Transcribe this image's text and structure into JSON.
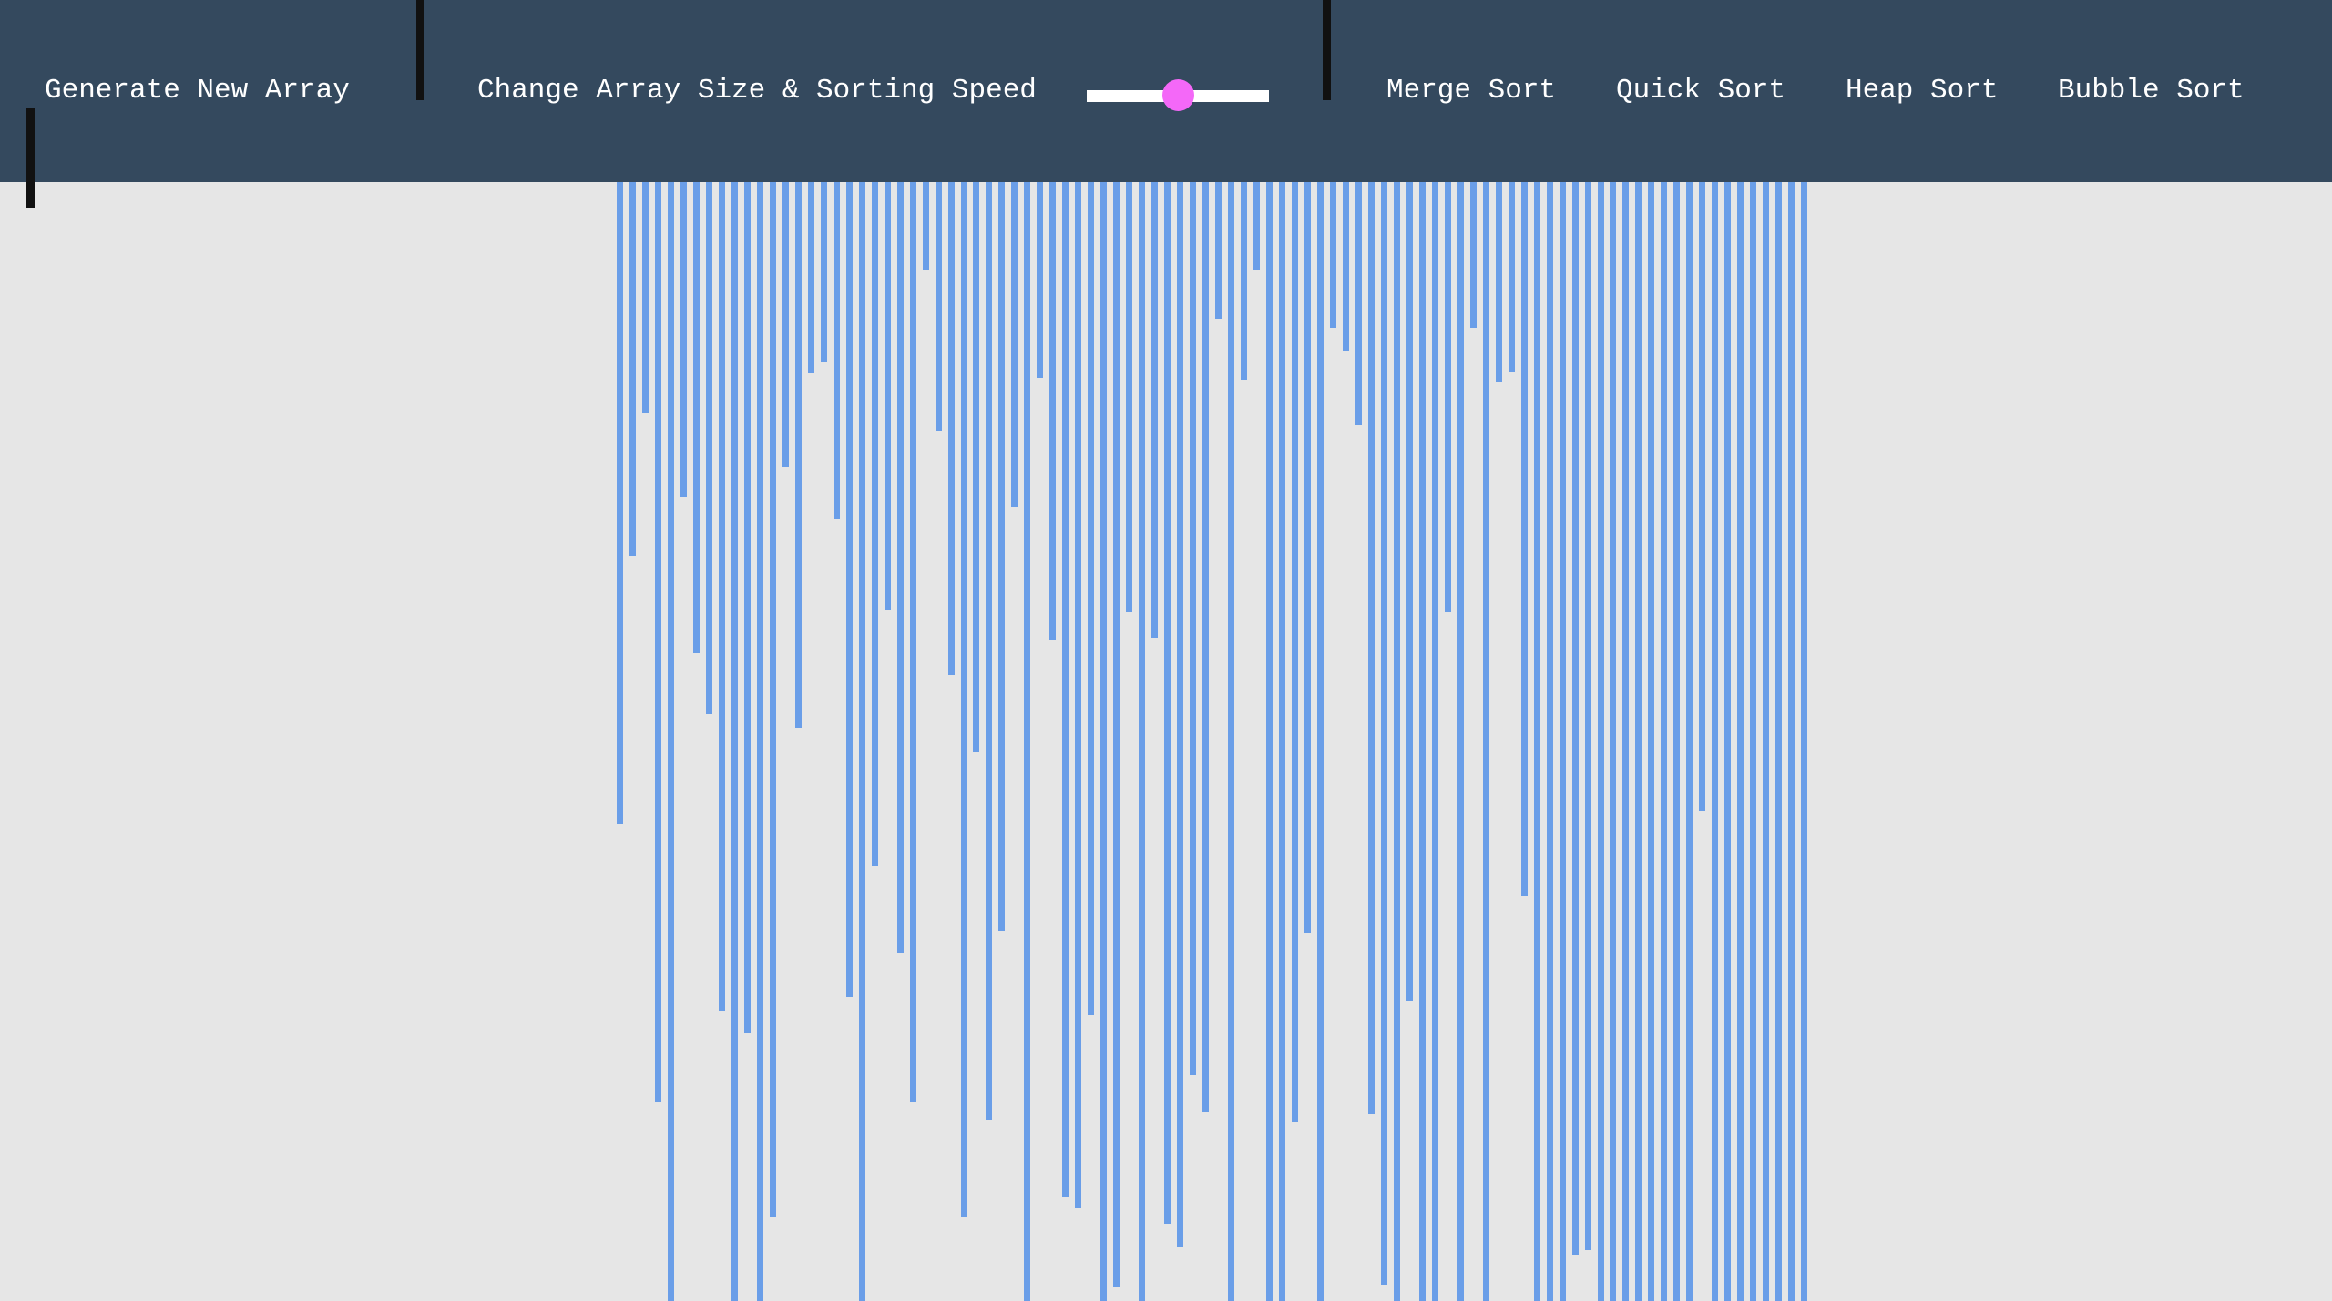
{
  "navbar": {
    "generate_label": "Generate New Array",
    "size_speed_label": "Change Array Size & Sorting Speed",
    "slider_value": 0.5,
    "algorithms": [
      "Merge Sort",
      "Quick Sort",
      "Heap Sort",
      "Bubble Sort"
    ]
  },
  "colors": {
    "navbar": "#34495e",
    "background": "#e6e6e6",
    "bar": "#6a9ee8",
    "slider_thumb": "#f468f8",
    "slider_track": "#ffffff",
    "text": "#ffffff"
  },
  "array": {
    "values": [
      704,
      410,
      253,
      1010,
      1231,
      345,
      517,
      584,
      910,
      1231,
      934,
      1231,
      1136,
      313,
      599,
      209,
      197,
      370,
      894,
      1231,
      751,
      469,
      846,
      1010,
      96,
      273,
      541,
      1136,
      625,
      1029,
      822,
      356,
      1231,
      215,
      503,
      1114,
      1126,
      914,
      1231,
      1213,
      472,
      1231,
      500,
      1143,
      1169,
      980,
      1021,
      150,
      1231,
      217,
      96,
      1233,
      1237,
      1031,
      824,
      1228,
      160,
      185,
      266,
      1023,
      1210,
      1253,
      899,
      1231,
      1231,
      472,
      1231,
      160,
      1231,
      219,
      208,
      783,
      1231,
      1231,
      1231,
      1177,
      1172,
      1231,
      1231,
      1231,
      1231,
      1231,
      1231,
      1231,
      1231,
      690,
      1231,
      1231,
      1231,
      1231,
      1231,
      1231,
      1231,
      1231
    ]
  }
}
